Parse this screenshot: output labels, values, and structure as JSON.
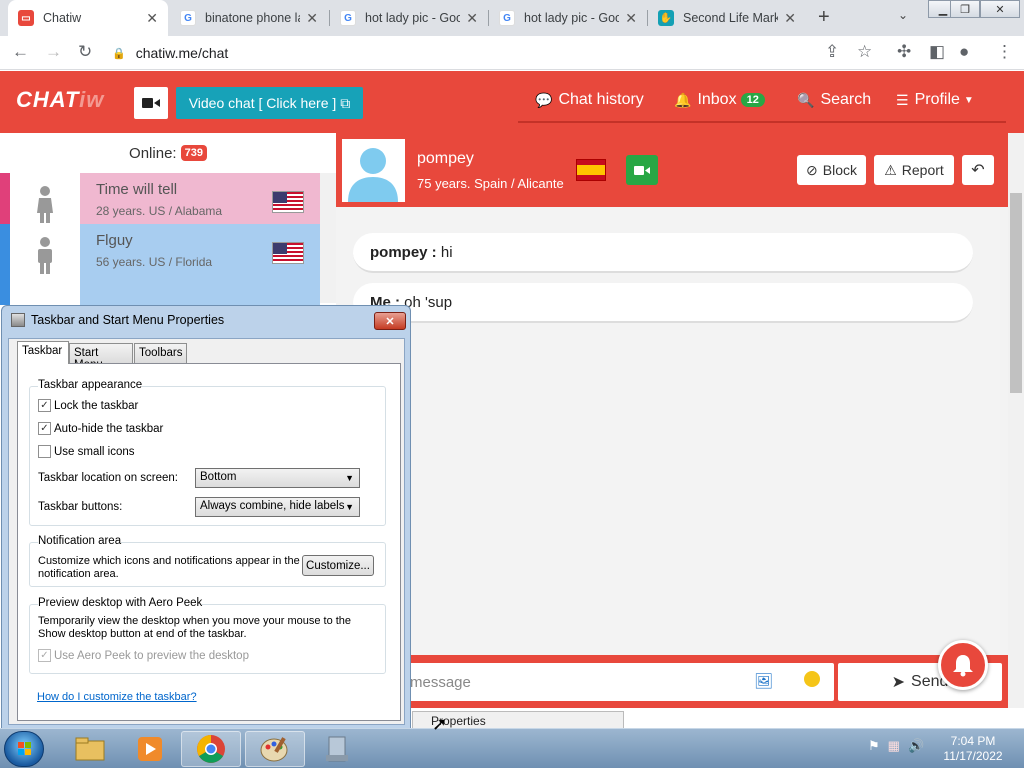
{
  "browser": {
    "tabs": [
      {
        "title": "Chatiw",
        "favicon": "chatiw-favicon",
        "active": true
      },
      {
        "title": "binatone phone la",
        "favicon": "google-g-icon",
        "active": false
      },
      {
        "title": "hot lady pic - Goo",
        "favicon": "google-g-icon",
        "active": false
      },
      {
        "title": "hot lady pic - Goo",
        "favicon": "google-g-icon",
        "active": false
      },
      {
        "title": "Second Life Marke",
        "favicon": "second-life-icon",
        "active": false
      }
    ],
    "url": "chatiw.me/chat"
  },
  "header": {
    "logo_text": "CHAT",
    "logo_suffix": "iw",
    "video_chat_label": "Video chat  [ Click here ]",
    "nav": {
      "chat_history": "Chat history",
      "inbox": "Inbox",
      "inbox_count": "12",
      "search": "Search",
      "profile": "Profile"
    },
    "accent_color": "#e8483c"
  },
  "sidebar": {
    "online_label": "Online:",
    "online_count": "739",
    "users": [
      {
        "name": "Time will tell",
        "meta": "28 years. US / Alabama",
        "color": "#f0b8d0",
        "stripe": "#e0407a",
        "country": "US"
      },
      {
        "name": "Flguy",
        "meta": "56 years. US / Florida",
        "color": "#a8cdf0",
        "stripe": "#3a8ee0",
        "country": "US"
      }
    ]
  },
  "chat": {
    "partner_name": "pompey",
    "partner_meta": "75 years. Spain / Alicante",
    "partner_country": "ES",
    "block_label": "Block",
    "report_label": "Report",
    "messages": [
      {
        "sender": "pompey :",
        "text": " hi"
      },
      {
        "sender": "Me :",
        "text": " oh 'sup"
      }
    ],
    "input_placeholder": "message",
    "send_label": "Send"
  },
  "context_tooltip": "Properties",
  "dialog": {
    "title": "Taskbar and Start Menu Properties",
    "tabs": [
      "Taskbar",
      "Start Menu",
      "Toolbars"
    ],
    "appearance": {
      "group_label": "Taskbar appearance",
      "lock": {
        "label": "Lock the taskbar",
        "checked": true
      },
      "autohide": {
        "label": "Auto-hide the taskbar",
        "checked": true
      },
      "small_icons": {
        "label": "Use small icons",
        "checked": false
      },
      "location_label": "Taskbar location on screen:",
      "location_value": "Bottom",
      "buttons_label": "Taskbar buttons:",
      "buttons_value": "Always combine, hide labels"
    },
    "notification": {
      "group_label": "Notification area",
      "text": "Customize which icons and notifications appear in the notification area.",
      "button": "Customize..."
    },
    "aero": {
      "group_label": "Preview desktop with Aero Peek",
      "text": "Temporarily view the desktop when you move your mouse to the Show desktop button at end of the taskbar.",
      "checkbox": "Use Aero Peek to preview the desktop",
      "checked": true,
      "disabled": true
    },
    "help_link": "How do I customize the taskbar?"
  },
  "taskbar": {
    "time": "7:04 PM",
    "date": "11/17/2022",
    "items": [
      "windows-explorer-icon",
      "media-player-icon",
      "chrome-icon",
      "paint-icon",
      "taskbar-properties-icon"
    ]
  }
}
